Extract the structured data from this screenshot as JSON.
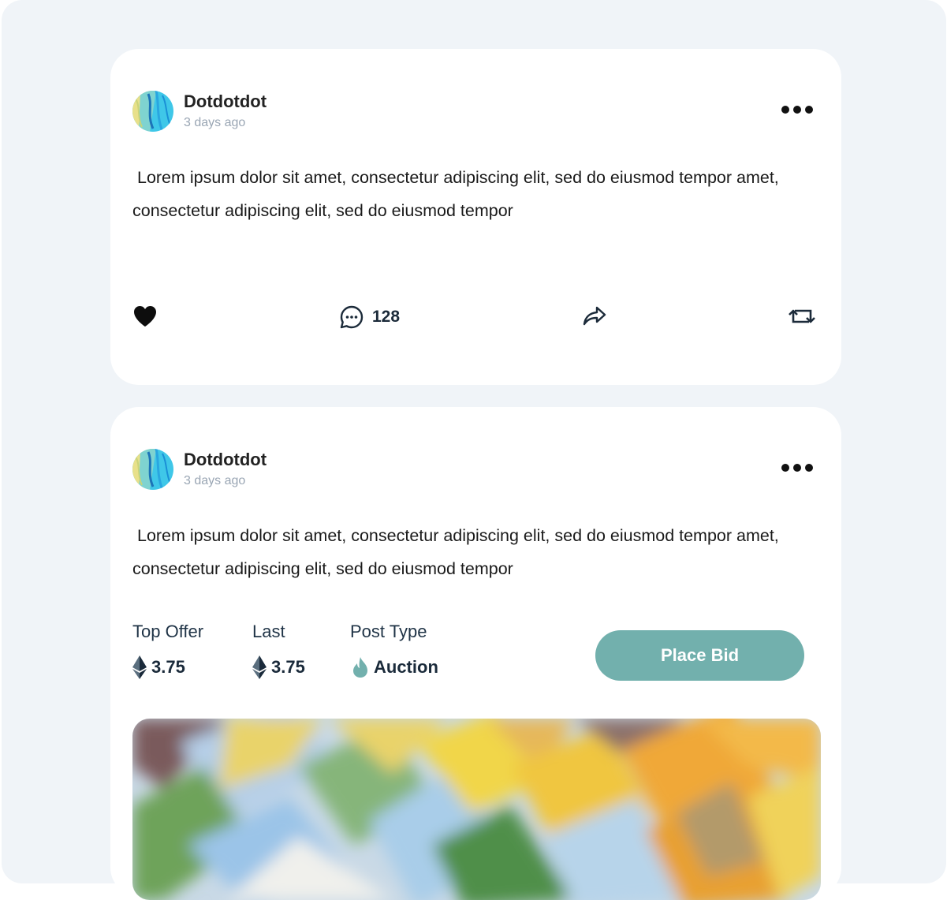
{
  "posts": [
    {
      "author": "Dotdotdot",
      "time": "3 days ago",
      "text": " Lorem ipsum dolor sit amet, consectetur adipiscing elit, sed do eiusmod tempor amet, consectetur adipiscing elit, sed do eiusmod tempor",
      "comment_count": "128",
      "icons": [
        "heart-icon",
        "comment-icon",
        "share-icon",
        "repost-icon",
        "more-icon"
      ]
    },
    {
      "author": "Dotdotdot",
      "time": "3 days ago",
      "text": " Lorem ipsum dolor sit amet, consectetur adipiscing elit, sed do eiusmod tempor amet, consectetur adipiscing elit, sed do eiusmod tempor",
      "stats": [
        {
          "label": "Top Offer",
          "value": "3.75",
          "icon": "ethereum-icon"
        },
        {
          "label": "Last",
          "value": "3.75",
          "icon": "ethereum-icon"
        },
        {
          "label": "Post Type",
          "value": "Auction",
          "icon": "flame-icon"
        }
      ],
      "cta_label": "Place Bid",
      "icons": [
        "more-icon",
        "ethereum-icon",
        "flame-icon"
      ]
    }
  ],
  "colors": {
    "background": "#f0f4f8",
    "card": "#ffffff",
    "accent": "#72b0ad",
    "muted_text": "#9aa6b4"
  }
}
